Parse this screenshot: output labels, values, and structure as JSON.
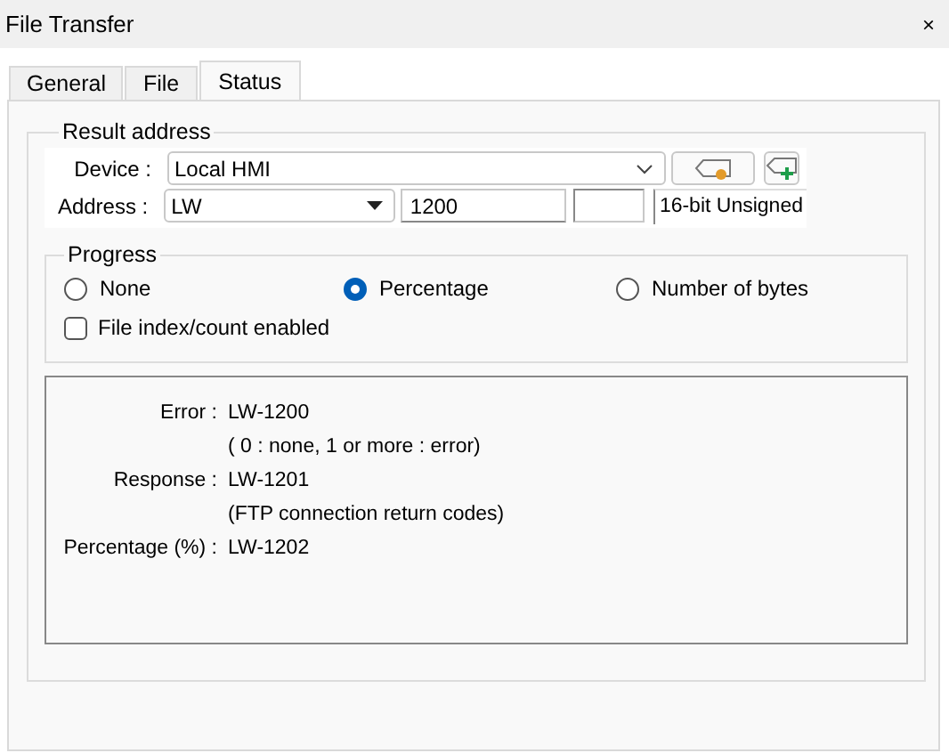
{
  "window": {
    "title": "File Transfer",
    "close": "×"
  },
  "tabs": [
    {
      "label": "General",
      "selected": false
    },
    {
      "label": "File",
      "selected": false
    },
    {
      "label": "Status",
      "selected": true
    }
  ],
  "result_address": {
    "legend": "Result address",
    "device": {
      "label": "Device :",
      "value": "Local HMI"
    },
    "address": {
      "label": "Address :",
      "type": "LW",
      "value": "1200"
    },
    "data_type": "16-bit Unsigned"
  },
  "progress": {
    "legend": "Progress",
    "options": [
      {
        "label": "None",
        "selected": false
      },
      {
        "label": "Percentage",
        "selected": true
      },
      {
        "label": "Number of bytes",
        "selected": false
      }
    ],
    "file_index": {
      "label": "File index/count enabled",
      "checked": false
    }
  },
  "info": [
    {
      "label": "Error :",
      "value": "LW-1200"
    },
    {
      "value": "( 0 : none, 1 or more : error)"
    },
    {
      "label": "Response :",
      "value": "LW-1201"
    },
    {
      "value": "(FTP connection return codes)"
    },
    {
      "label": "Percentage (%) :",
      "value": "LW-1202"
    }
  ]
}
